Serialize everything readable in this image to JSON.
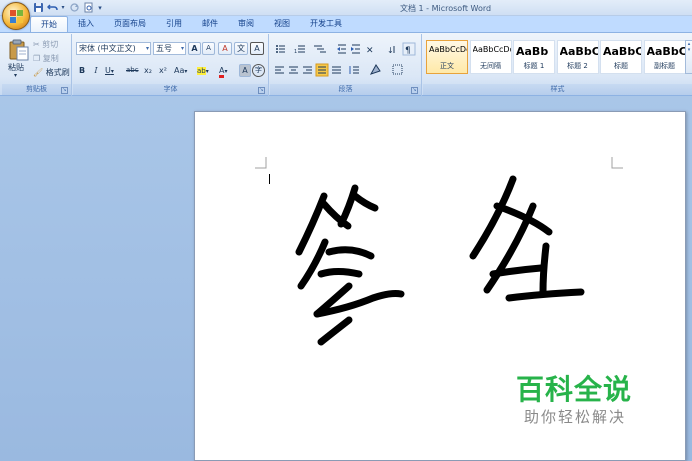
{
  "window": {
    "title": "文档 1 - Microsoft Word"
  },
  "quick_access": [
    {
      "name": "save-icon",
      "glyph": "💾"
    },
    {
      "name": "undo-icon",
      "glyph": "↶"
    },
    {
      "name": "redo-icon",
      "glyph": "↷"
    },
    {
      "name": "print-preview-icon",
      "glyph": "🔍"
    },
    {
      "name": "customize-qat-icon",
      "glyph": "▾"
    }
  ],
  "tabs": [
    "开始",
    "插入",
    "页面布局",
    "引用",
    "邮件",
    "审阅",
    "视图",
    "开发工具"
  ],
  "clipboard": {
    "paste": "粘贴",
    "cut": "剪切",
    "copy": "复制",
    "format_painter": "格式刷",
    "group_label": "剪贴板"
  },
  "font": {
    "font_name": "宋体 (中文正文)",
    "font_size": "五号",
    "grow_glyph": "A",
    "shrink_glyph": "A",
    "clear_glyph": "A",
    "phonetic_glyph": "文",
    "border_glyph": "A",
    "bold": "B",
    "italic": "I",
    "underline": "U",
    "strike": "abc",
    "subscript": "x₂",
    "superscript": "x²",
    "change_case": "Aa",
    "highlight_glyph": "ab",
    "font_color_glyph": "A",
    "char_shading_glyph": "A",
    "enclose_glyph": "字",
    "group_label": "字体"
  },
  "paragraph": {
    "group_label": "段落"
  },
  "styles": {
    "items": [
      {
        "sample": "AaBbCcDd",
        "name": "正文",
        "selected": true,
        "big": false
      },
      {
        "sample": "AaBbCcDd",
        "name": "无间隔",
        "selected": false,
        "big": false
      },
      {
        "sample": "AaBb",
        "name": "标题 1",
        "selected": false,
        "big": true
      },
      {
        "sample": "AaBbC",
        "name": "标题 2",
        "selected": false,
        "big": true
      },
      {
        "sample": "AaBbC",
        "name": "标题",
        "selected": false,
        "big": true
      },
      {
        "sample": "AaBbC",
        "name": "副标题",
        "selected": false,
        "big": true
      }
    ],
    "group_label": "样式"
  },
  "watermark": {
    "title": "百科全说",
    "subtitle": "助你轻松解决"
  },
  "colors": {
    "accent": "#27b34a",
    "ribbon": "#dbe7f6",
    "tab_text": "#15428b"
  }
}
